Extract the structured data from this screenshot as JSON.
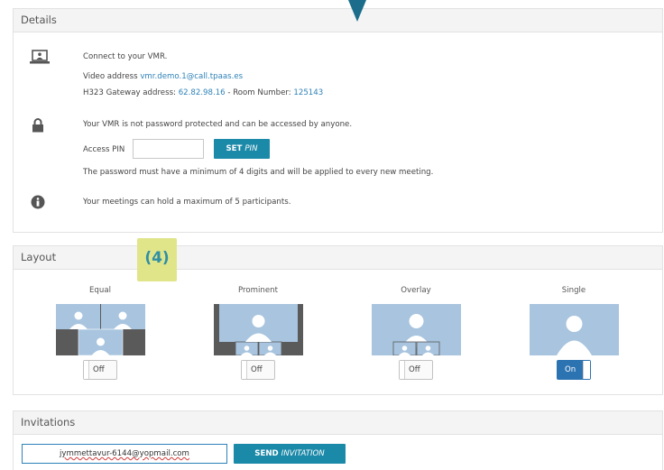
{
  "details": {
    "title": "Details",
    "connect_text": "Connect to your VMR.",
    "video_label": "Video address ",
    "video_value": "vmr.demo.1@call.tpaas.es",
    "gateway_label": "H323 Gateway address: ",
    "gateway_value": "62.82.98.16",
    "room_sep": " - Room Number: ",
    "room_value": "125143",
    "password_warning": "Your VMR is not password protected and can be accessed by anyone.",
    "pin_label": "Access PIN",
    "pin_value": "",
    "set_pin_bold": "SET ",
    "set_pin_italic": "PIN",
    "pin_note": "The password must have a minimum of 4 digits and will be applied to every new meeting.",
    "participants_note": "Your meetings can hold a maximum of 5 participants.",
    "icons": [
      "laptop-user-icon",
      "lock-icon",
      "info-icon"
    ]
  },
  "annotation": {
    "label": "(4)"
  },
  "layout": {
    "title": "Layout",
    "options": [
      {
        "label": "Equal",
        "state": "Off"
      },
      {
        "label": "Prominent",
        "state": "Off"
      },
      {
        "label": "Overlay",
        "state": "Off"
      },
      {
        "label": "Single",
        "state": "On"
      }
    ]
  },
  "invitations": {
    "title": "Invitations",
    "email_value": "jymmettavur-6144@yopmail.com",
    "send_bold": "SEND ",
    "send_italic": "INVITATION"
  },
  "colors": {
    "accent": "#1b89a8",
    "toggle_on": "#2c73b2",
    "link": "#2e82b8",
    "badge_bg": "#e0e58a",
    "thumb_bg": "#a8c4df"
  }
}
